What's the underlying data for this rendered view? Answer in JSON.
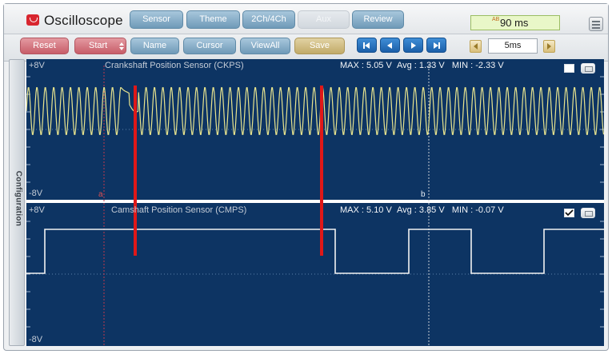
{
  "app": {
    "title": "Oscilloscope"
  },
  "title_tabs": [
    {
      "label": "Sensor",
      "enabled": true
    },
    {
      "label": "Theme",
      "enabled": true
    },
    {
      "label": "2Ch/4Ch",
      "enabled": true
    },
    {
      "label": "Aux",
      "enabled": false
    },
    {
      "label": "Review",
      "enabled": true
    }
  ],
  "timer": {
    "prefix": "AB",
    "value": "90 ms"
  },
  "toolbar": {
    "reset": "Reset",
    "start": "Start",
    "name": "Name",
    "cursor": "Cursor",
    "viewall": "ViewAll",
    "save": "Save",
    "zoom_value": "5ms"
  },
  "sidebar": {
    "label": "Configuration"
  },
  "channels": [
    {
      "name": "Crankshaft Position Sensor (CKPS)",
      "top_label": "+8V",
      "bottom_label": "-8V",
      "max_label": "MAX",
      "max_value": "5.05 V",
      "avg_label": "Avg",
      "avg_value": "1.33 V",
      "min_label": "MIN",
      "min_value": "-2.33 V",
      "checked": false,
      "waveform": "sine",
      "color": "#e8e48e"
    },
    {
      "name": "Camshaft Position Sensor (CMPS)",
      "top_label": "+8V",
      "bottom_label": "-8V",
      "max_label": "MAX",
      "max_value": "5.10 V",
      "avg_label": "Avg",
      "avg_value": "3.85 V",
      "min_label": "MIN",
      "min_value": "-0.07 V",
      "checked": true,
      "waveform": "square",
      "color": "#f2f2f2"
    }
  ],
  "cursor_markers": {
    "a": "a",
    "b": "b"
  },
  "colors": {
    "scope_bg": "#0d3463",
    "grid": "#5c7fa8",
    "marker_red": "#e01818",
    "cursor_b": "#c9ced6"
  },
  "icons": {
    "app": "oscilloscope-logo-icon",
    "menu": "hamburger-menu-icon",
    "nav": [
      "skip-first-icon",
      "step-back-icon",
      "play-icon",
      "skip-last-icon"
    ],
    "zoom": [
      "zoom-decrease-icon",
      "zoom-increase-icon"
    ]
  }
}
